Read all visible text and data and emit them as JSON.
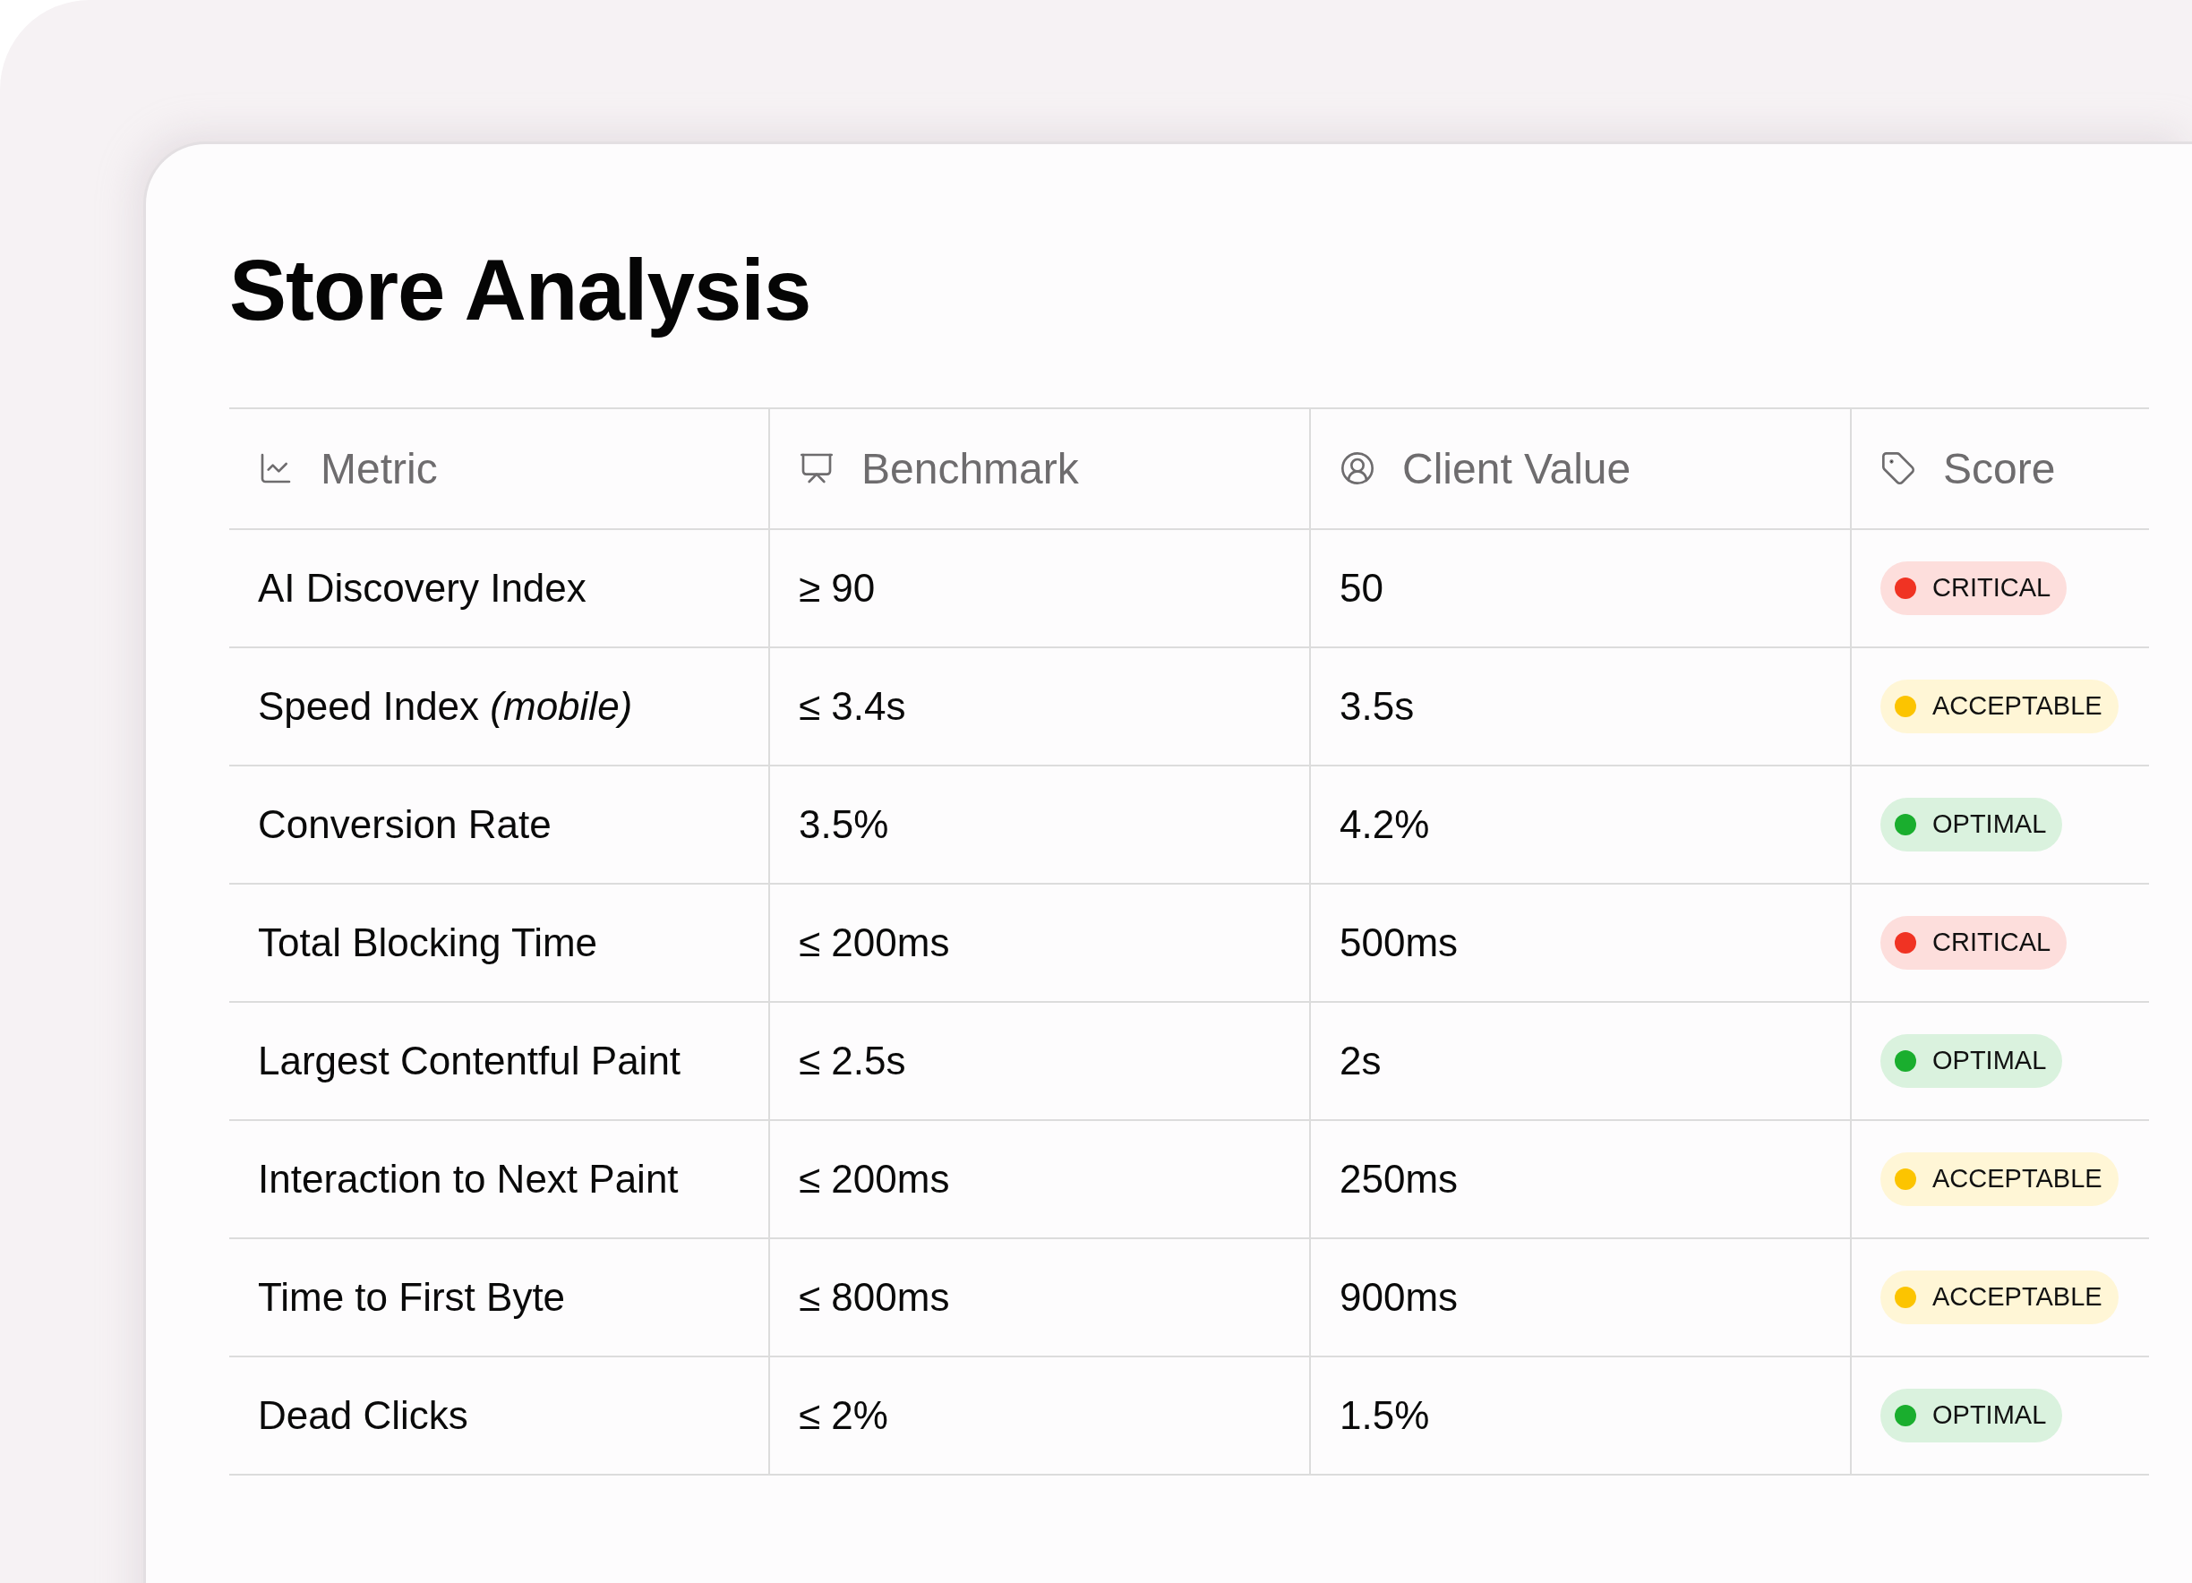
{
  "title": "Store Analysis",
  "columns": [
    {
      "label": "Metric"
    },
    {
      "label": "Benchmark"
    },
    {
      "label": "Client Value"
    },
    {
      "label": "Score"
    }
  ],
  "rows": [
    {
      "metric": "AI Discovery Index",
      "benchmark": "≥ 90",
      "client_value": "50",
      "score": {
        "label": "CRITICAL",
        "color": "#f03323"
      }
    },
    {
      "metric": "Speed Index *(mobile)*",
      "benchmark": "≤ 3.4s",
      "client_value": "3.5s",
      "score": {
        "label": "ACCEPTABLE",
        "color": "#fcc400"
      }
    },
    {
      "metric": "Conversion Rate",
      "benchmark": "3.5%",
      "client_value": "4.2%",
      "score": {
        "label": "OPTIMAL",
        "color": "#1aae2e"
      }
    },
    {
      "metric": "Total Blocking Time",
      "benchmark": "≤ 200ms",
      "client_value": "500ms",
      "score": {
        "label": "CRITICAL",
        "color": "#f03323"
      }
    },
    {
      "metric": "Largest Contentful Paint",
      "benchmark": "≤ 2.5s",
      "client_value": "2s",
      "score": {
        "label": "OPTIMAL",
        "color": "#1aae2e"
      }
    },
    {
      "metric": "Interaction to Next Paint",
      "benchmark": "≤ 200ms",
      "client_value": "250ms",
      "score": {
        "label": "ACCEPTABLE",
        "color": "#fcc400"
      }
    },
    {
      "metric": "Time to First Byte",
      "benchmark": "≤ 800ms",
      "client_value": "900ms",
      "score": {
        "label": "ACCEPTABLE",
        "color": "#fcc400"
      }
    },
    {
      "metric": "Dead Clicks",
      "benchmark": "≤ 2%",
      "client_value": "1.5%",
      "score": {
        "label": "OPTIMAL",
        "color": "#1aae2e"
      }
    }
  ]
}
